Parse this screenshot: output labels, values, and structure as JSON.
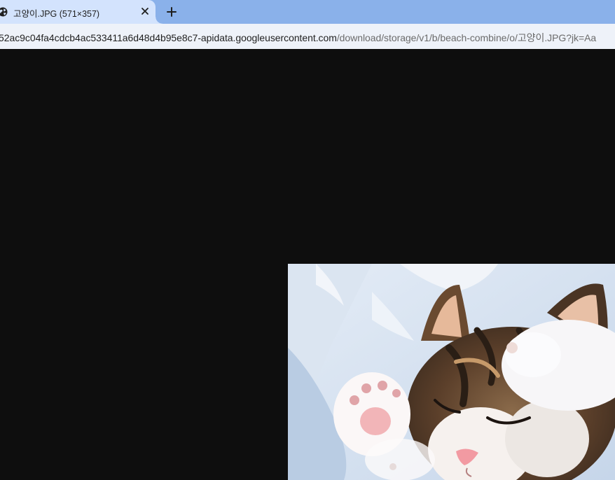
{
  "tab": {
    "title": "고양이.JPG (571×357)",
    "icon": "globe-icon",
    "close_icon": "close-icon"
  },
  "toolbar": {
    "new_tab_icon": "plus-icon"
  },
  "address_bar": {
    "url_domain": "52ac9c04fa4cdcb4ac533411a6d48d4b95e8c7-apidata.googleusercontent.com",
    "url_path": "/download/storage/v1/b/beach-combine/o/고양이.JPG?jk=Aa"
  },
  "image": {
    "subject": "kitten sleeping on white fleece blanket"
  },
  "colors": {
    "tab_strip": "#8ab1ea",
    "active_tab": "#d3e3fd",
    "viewer_background": "#0e0e0e"
  }
}
